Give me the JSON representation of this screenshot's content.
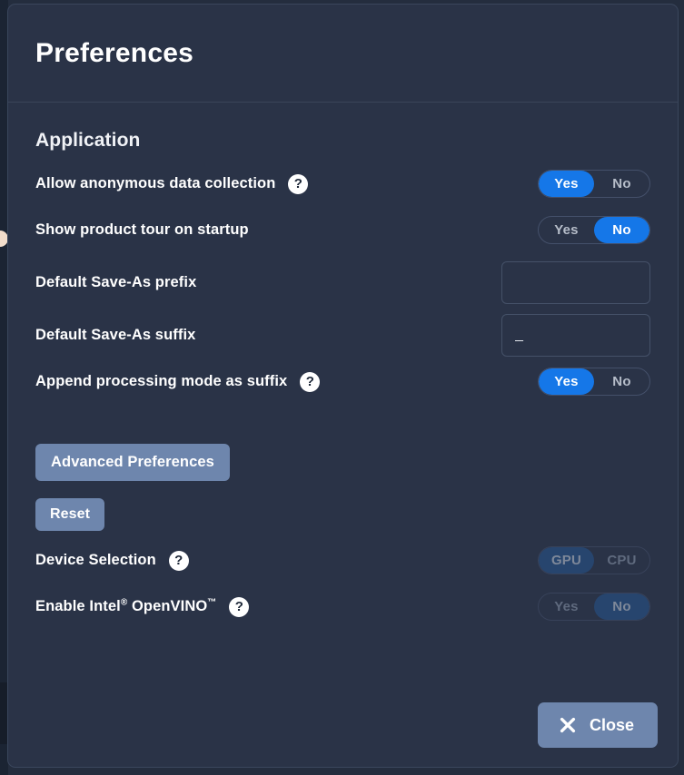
{
  "window": {
    "title": "Preferences"
  },
  "sections": [
    {
      "title": "Application"
    }
  ],
  "settings": {
    "anonymous_data": {
      "label": "Allow anonymous data collection",
      "help_icon": "question-mark-icon",
      "options": [
        "Yes",
        "No"
      ],
      "selected": "Yes"
    },
    "product_tour": {
      "label": "Show product tour on startup",
      "options": [
        "Yes",
        "No"
      ],
      "selected": "No"
    },
    "save_as_prefix": {
      "label": "Default Save-As prefix",
      "value": "",
      "placeholder": ""
    },
    "save_as_suffix": {
      "label": "Default Save-As suffix",
      "value": "_",
      "placeholder": ""
    },
    "append_mode_suffix": {
      "label": "Append processing mode as suffix",
      "help_icon": "question-mark-icon",
      "options": [
        "Yes",
        "No"
      ],
      "selected": "Yes"
    },
    "device_selection": {
      "label": "Device Selection",
      "help_icon": "question-mark-icon",
      "options": [
        "GPU",
        "CPU"
      ],
      "selected": "GPU",
      "disabled": true
    },
    "openvino": {
      "label_parts": {
        "pre": "Enable Intel",
        "reg": "®",
        "mid": " OpenVINO",
        "tm": "™"
      },
      "help_icon": "question-mark-icon",
      "options": [
        "Yes",
        "No"
      ],
      "selected": "No",
      "disabled": true
    }
  },
  "buttons": {
    "advanced_preferences": "Advanced Preferences",
    "reset": "Reset",
    "close": "Close",
    "close_icon": "close-x-icon"
  },
  "colors": {
    "accent_blue": "#1577e8",
    "button_blue_gray": "#6e86ad",
    "modal_bg": "#2a3347",
    "text_white": "#ffffff",
    "disabled_text": "#5f6a7e"
  }
}
